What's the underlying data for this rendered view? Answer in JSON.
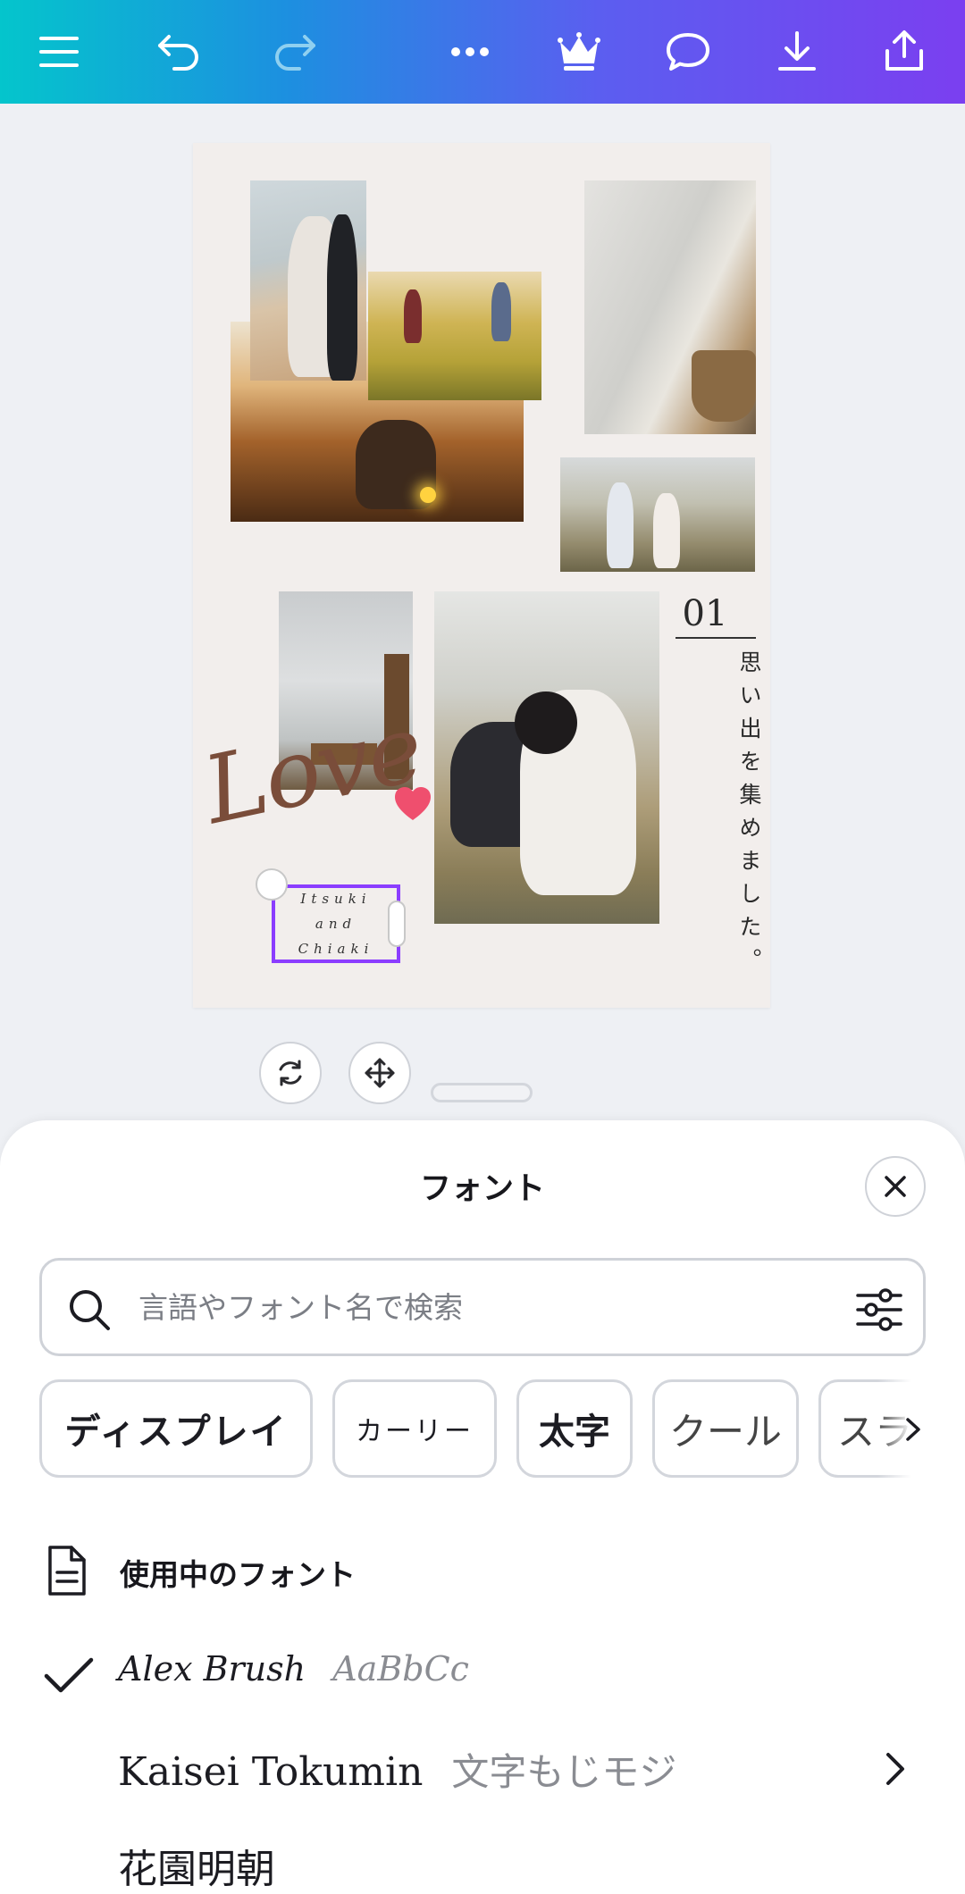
{
  "toolbar": {
    "icons": [
      "menu-icon",
      "undo-icon",
      "redo-icon",
      "more-icon",
      "crown-icon",
      "comment-icon",
      "download-icon",
      "share-icon"
    ],
    "colors": {
      "gradient_start": "#04c5cc",
      "gradient_end": "#7b3ff0"
    }
  },
  "design": {
    "number_label": "01",
    "vertical_caption": "思い出を集めました。",
    "love_script": "Love",
    "selected_text": [
      "Itsuki",
      "and",
      "Chiaki"
    ],
    "selection_color": "#8b3dff"
  },
  "font_sheet": {
    "title": "フォント",
    "search": {
      "placeholder": "言語やフォント名で検索",
      "value": ""
    },
    "chips": [
      "ディスプレイ",
      "カーリー",
      "太字",
      "クール",
      "スラ"
    ],
    "section_title": "使用中のフォント",
    "fonts": [
      {
        "name": "Alex Brush",
        "sample": "AaBbCc",
        "selected": true
      },
      {
        "name": "Kaisei Tokumin",
        "sample": "文字もじモジ",
        "has_submenu": true
      },
      {
        "name": "花園明朝",
        "sample": ""
      }
    ]
  }
}
